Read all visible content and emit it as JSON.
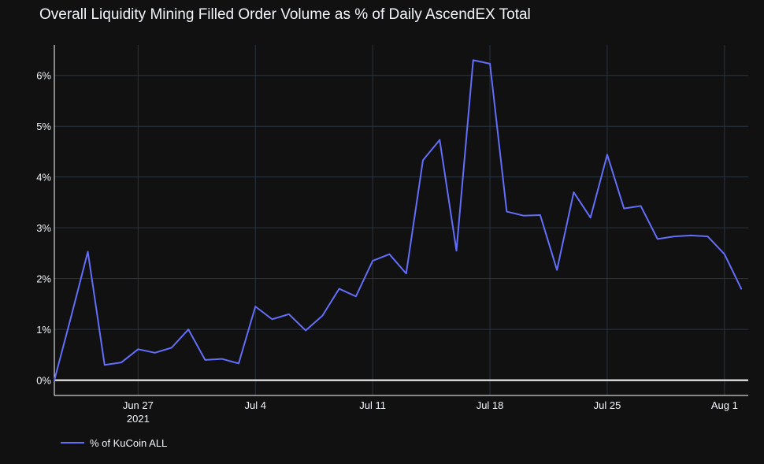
{
  "chart_data": {
    "type": "line",
    "title": "Overall Liquidity Mining Filled Order Volume as % of Daily AscendEX Total",
    "xlabel": "",
    "ylabel": "",
    "x_range": [
      "2021-06-22",
      "2021-08-02T10:00"
    ],
    "ylim": [
      -0.3,
      6.6
    ],
    "y_ticks": [
      0,
      1,
      2,
      3,
      4,
      5,
      6
    ],
    "y_tick_labels": [
      "0%",
      "1%",
      "2%",
      "3%",
      "4%",
      "5%",
      "6%"
    ],
    "x_ticks": [
      "2021-06-27",
      "2021-07-04",
      "2021-07-11",
      "2021-07-18",
      "2021-07-25",
      "2021-08-01"
    ],
    "x_tick_labels": [
      "Jun 27",
      "Jul 4",
      "Jul 11",
      "Jul 18",
      "Jul 25",
      "Aug 1"
    ],
    "x_tick_sublabel": "2021",
    "grid": true,
    "legend_position": "bottom-left",
    "colors": {
      "background": "#111111",
      "grid": "#283442",
      "zero_line": "#ffffff",
      "axis_line": "#ffffff",
      "text": "#f2f5fa",
      "series": "#636efa"
    },
    "series": [
      {
        "name": "% of KuCoin ALL",
        "color": "#636efa",
        "x": [
          "2021-06-22",
          "2021-06-23",
          "2021-06-24",
          "2021-06-25",
          "2021-06-26",
          "2021-06-27",
          "2021-06-28",
          "2021-06-29",
          "2021-06-30",
          "2021-07-01",
          "2021-07-02",
          "2021-07-03",
          "2021-07-04",
          "2021-07-05",
          "2021-07-06",
          "2021-07-07",
          "2021-07-08",
          "2021-07-09",
          "2021-07-10",
          "2021-07-11",
          "2021-07-12",
          "2021-07-13",
          "2021-07-14",
          "2021-07-15",
          "2021-07-16",
          "2021-07-17",
          "2021-07-18",
          "2021-07-19",
          "2021-07-20",
          "2021-07-21",
          "2021-07-22",
          "2021-07-23",
          "2021-07-24",
          "2021-07-25",
          "2021-07-26",
          "2021-07-27",
          "2021-07-28",
          "2021-07-29",
          "2021-07-30",
          "2021-07-31",
          "2021-08-01",
          "2021-08-02"
        ],
        "y": [
          0.0,
          1.25,
          2.53,
          0.3,
          0.35,
          0.61,
          0.54,
          0.64,
          1.0,
          0.4,
          0.42,
          0.33,
          1.45,
          1.2,
          1.3,
          0.98,
          1.27,
          1.8,
          1.65,
          2.35,
          2.48,
          2.1,
          4.33,
          4.73,
          2.55,
          6.3,
          6.23,
          3.32,
          3.24,
          3.25,
          2.17,
          3.7,
          3.2,
          4.44,
          3.38,
          3.43,
          2.78,
          2.83,
          2.85,
          2.83,
          2.48,
          1.8
        ]
      }
    ]
  }
}
